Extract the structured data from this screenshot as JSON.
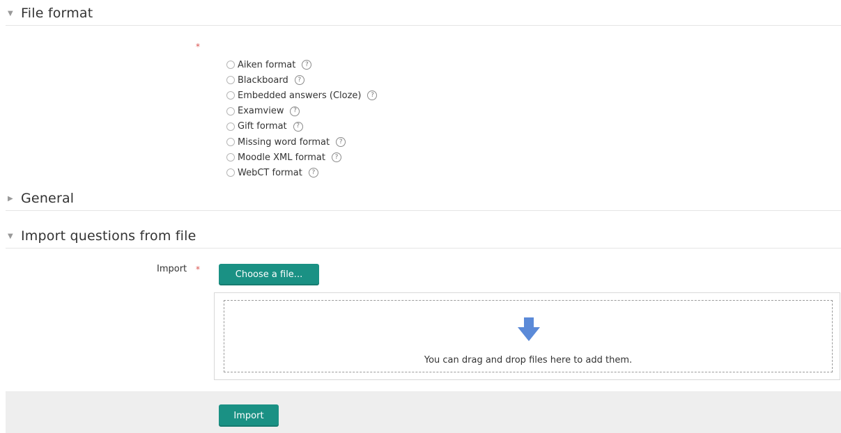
{
  "sections": {
    "file_format": {
      "title": "File format",
      "caret": "▼"
    },
    "general": {
      "title": "General",
      "caret": "▶"
    },
    "import_from_file": {
      "title": "Import questions from file",
      "caret": "▼"
    }
  },
  "file_format": {
    "required_marker": "*",
    "options": [
      {
        "label": "Aiken format",
        "help_icon": "question-circle-icon"
      },
      {
        "label": "Blackboard",
        "help_icon": "question-circle-icon"
      },
      {
        "label": "Embedded answers (Cloze)",
        "help_icon": "question-circle-icon"
      },
      {
        "label": "Examview",
        "help_icon": "question-circle-icon"
      },
      {
        "label": "Gift format",
        "help_icon": "question-circle-icon"
      },
      {
        "label": "Missing word format",
        "help_icon": "question-circle-icon"
      },
      {
        "label": "Moodle XML format",
        "help_icon": "question-circle-icon"
      },
      {
        "label": "WebCT format",
        "help_icon": "question-circle-icon"
      }
    ],
    "help_glyph": "?"
  },
  "import_field": {
    "label": "Import",
    "required_marker": "*",
    "choose_button_label": "Choose a file...",
    "drop_text": "You can drag and drop files here to add them.",
    "drop_icon": "down-arrow-icon"
  },
  "footer": {
    "import_button_label": "Import"
  },
  "colors": {
    "accent": "#1a9184",
    "required": "#d9534f",
    "drop_arrow": "#5b8ad8"
  }
}
